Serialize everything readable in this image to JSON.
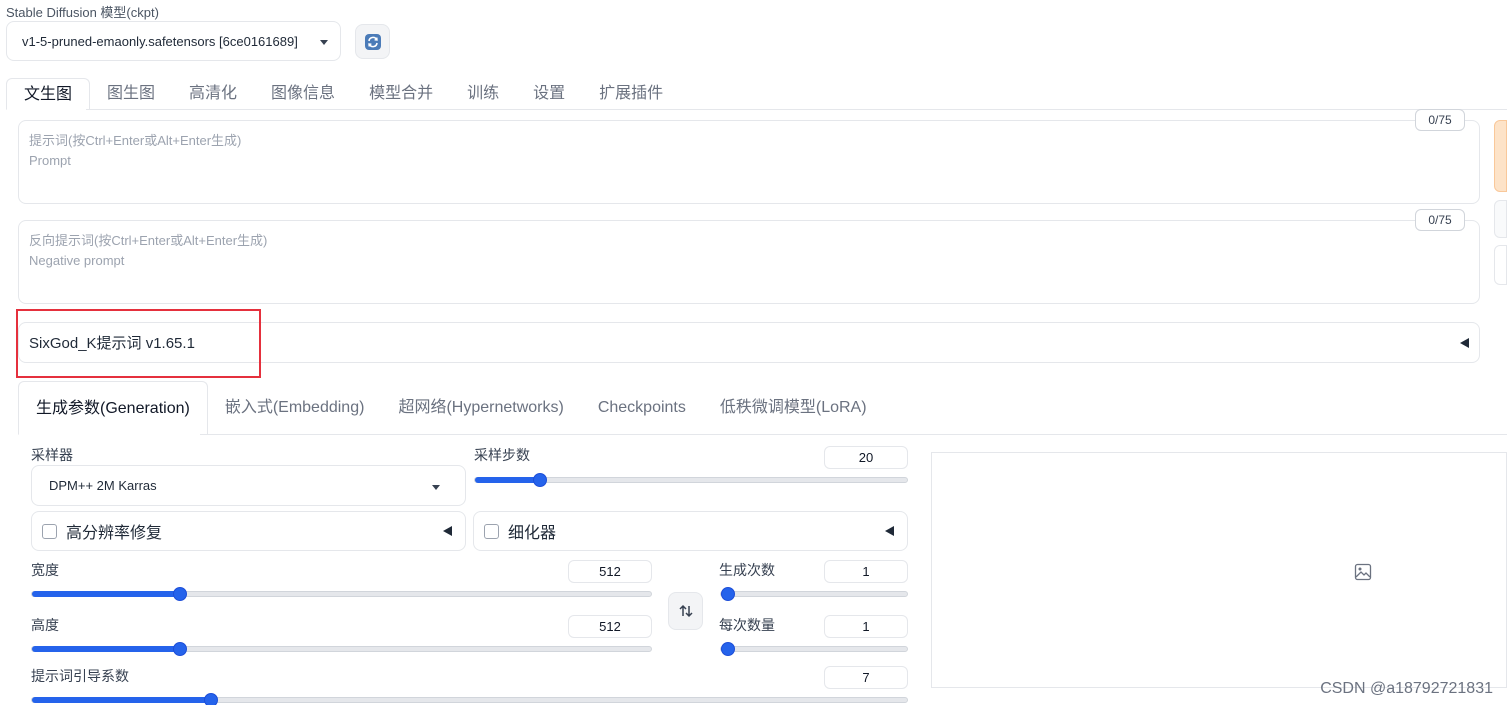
{
  "checkpoint": {
    "label": "Stable Diffusion 模型(ckpt)",
    "selected": "v1-5-pruned-emaonly.safetensors [6ce0161689]"
  },
  "main_tabs": [
    {
      "label": "文生图"
    },
    {
      "label": "图生图"
    },
    {
      "label": "高清化"
    },
    {
      "label": "图像信息"
    },
    {
      "label": "模型合并"
    },
    {
      "label": "训练"
    },
    {
      "label": "设置"
    },
    {
      "label": "扩展插件"
    }
  ],
  "prompt": {
    "placeholder_line1": "提示词(按Ctrl+Enter或Alt+Enter生成)",
    "placeholder_line2": "Prompt",
    "counter": "0/75"
  },
  "negative_prompt": {
    "placeholder_line1": "反向提示词(按Ctrl+Enter或Alt+Enter生成)",
    "placeholder_line2": "Negative prompt",
    "counter": "0/75"
  },
  "extension_accordion": {
    "title": "SixGod_K提示词 v1.65.1"
  },
  "gen_tabs": [
    {
      "label": "生成参数(Generation)"
    },
    {
      "label": "嵌入式(Embedding)"
    },
    {
      "label": "超网络(Hypernetworks)"
    },
    {
      "label": "Checkpoints"
    },
    {
      "label": "低秩微调模型(LoRA)"
    }
  ],
  "sampler": {
    "label": "采样器",
    "selected": "DPM++ 2M Karras"
  },
  "steps": {
    "label": "采样步数",
    "value": "20",
    "fraction": 0.138
  },
  "hires_fix": {
    "label": "高分辨率修复"
  },
  "refiner": {
    "label": "细化器"
  },
  "width": {
    "label": "宽度",
    "value": "512",
    "fraction": 0.233
  },
  "height": {
    "label": "高度",
    "value": "512",
    "fraction": 0.233
  },
  "batch_count": {
    "label": "生成次数",
    "value": "1",
    "fraction": 0.0
  },
  "batch_size": {
    "label": "每次数量",
    "value": "1",
    "fraction": 0.0
  },
  "cfg_scale": {
    "label": "提示词引导系数",
    "value": "7",
    "fraction": 0.2
  },
  "watermark": "CSDN @a18792721831",
  "colors": {
    "accent": "#2563eb",
    "highlight_box": "#e5303d"
  }
}
